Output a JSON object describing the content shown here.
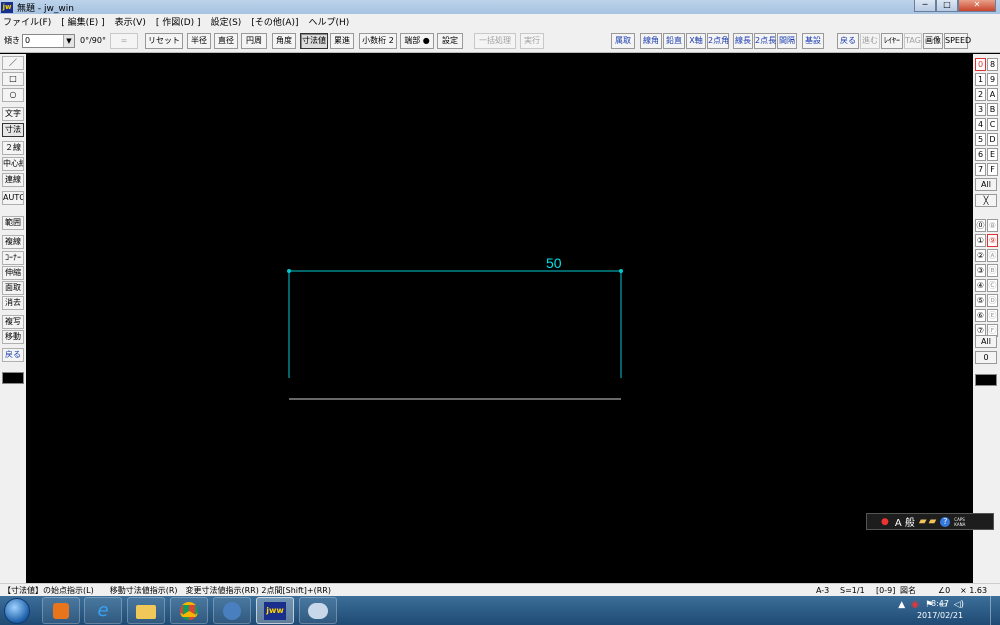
{
  "window": {
    "title": "無題 - jw_win",
    "app_icon_label": "jw"
  },
  "menu": [
    "ファイル(F)",
    "[ 編集(E) ]",
    "表示(V)",
    "[ 作図(D) ]",
    "設定(S)",
    "[その他(A)]",
    "ヘルプ(H)"
  ],
  "toolbar": {
    "angle_label": "傾き",
    "angle_value": "0",
    "angle_90": "0°/90°",
    "eq_button": "=",
    "reset": "リセット",
    "radius": "半径",
    "diameter": "直径",
    "circumference": "円周",
    "angle": "角度",
    "dimension_value": "寸法値",
    "continuous": "累進",
    "decimal_places": "小数桁 2",
    "end_mark": "端部 ●",
    "settings": "設定",
    "batch": "一括処理",
    "execute": "実行",
    "right_buttons": [
      "属取",
      "線角",
      "鉛直",
      "X軸",
      "2点角",
      "線長",
      "2点長",
      "間隔",
      "基設",
      "戻る",
      "進む",
      "ﾚｲﾔｰ",
      "TAG",
      "画像",
      "SPEED"
    ]
  },
  "left_tools": [
    "／",
    "□",
    "○",
    "文字",
    "寸法",
    "２線",
    "中心線",
    "連線",
    "AUTO",
    "範囲",
    "複線",
    "ｺｰﾅｰ",
    "伸縮",
    "面取",
    "消去",
    "複写",
    "移動",
    "戻る"
  ],
  "right_layers": {
    "group_a": [
      [
        "0",
        "8"
      ],
      [
        "1",
        "9"
      ],
      [
        "2",
        "A"
      ],
      [
        "3",
        "B"
      ],
      [
        "4",
        "C"
      ],
      [
        "5",
        "D"
      ],
      [
        "6",
        "E"
      ],
      [
        "7",
        "F"
      ]
    ],
    "all_a": "All",
    "x_a": "╳",
    "group_b": [
      [
        "⓪",
        "⑧"
      ],
      [
        "①",
        "⑨"
      ],
      [
        "②",
        "Ⓐ"
      ],
      [
        "③",
        "Ⓑ"
      ],
      [
        "④",
        "Ⓒ"
      ],
      [
        "⑤",
        "Ⓓ"
      ],
      [
        "⑥",
        "Ⓔ"
      ],
      [
        "⑦",
        "Ⓕ"
      ]
    ],
    "all_b": "All",
    "zero_b": "0"
  },
  "drawing": {
    "dimension_text": "50",
    "line_color": "#00c8d0",
    "text_color": "#00e0e8",
    "base_line_color": "#d0d0d0"
  },
  "float_bar": {
    "text": "A 般",
    "small": "CAPS KANA"
  },
  "status": {
    "hint": "【寸法値】の始点指示(L)　　移動寸法値指示(R)　変更寸法値指示(RR) 2点間[Shift]+(RR)",
    "paper": "A-3",
    "scale": "S=1/1",
    "layer": "[0-9]",
    "layer_name": "図名",
    "angle": "∠0",
    "zoom": "× 1.63"
  },
  "taskbar": {
    "time": "8:47",
    "date": "2017/02/21"
  }
}
